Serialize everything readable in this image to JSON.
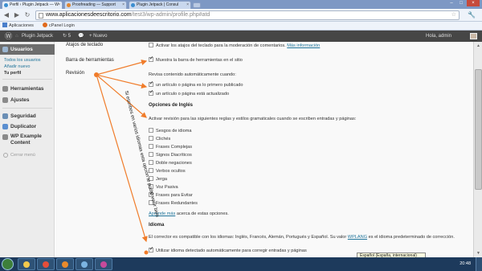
{
  "browser": {
    "tabs": [
      {
        "label": "Perfil ‹ Plugin Jetpack — W",
        "active": true
      },
      {
        "label": "Proofreading — Support",
        "active": false
      },
      {
        "label": "Plugin Jetpack | Consul",
        "active": false
      }
    ],
    "url_host": "www.aplicacionesdeescritorio.com",
    "url_path": "/test3/wp-admin/profile.php#atd",
    "bookmarks": [
      {
        "label": "Aplicaciones"
      },
      {
        "label": "cPanel Login"
      }
    ]
  },
  "admin_bar": {
    "site_name": "Plugin Jetpack",
    "updates_count": "5",
    "new_label": "+ Nuevo",
    "greeting": "Hola, admin"
  },
  "sidebar": {
    "usuarios": "Usuarios",
    "subitems": [
      "Todos los usuarios",
      "Añadir nuevo",
      "Tu perfil"
    ],
    "herramientas": "Herramientas",
    "ajustes": "Ajustes",
    "seguridad": "Seguridad",
    "duplicator": "Duplicator",
    "wp_example_1": "WP Example",
    "wp_example_2": "Content",
    "collapse": "Cerrar menú"
  },
  "main": {
    "top_label": "Atajos de teclado",
    "top_option": "Activar los atajos del teclado para la moderación de comentarios.",
    "top_link": "Más información",
    "toolbar_label": "Barra de herramientas",
    "toolbar_option": "Muestra la barra de herramientas en el sitio",
    "revision_label": "Revisión",
    "revision_desc": "Revisa contenido automáticamente cuando:",
    "revision_opts": [
      {
        "label": "un artículo o página es lo primero publicado",
        "checked": true
      },
      {
        "label": "un artículo o página está actualizado",
        "checked": true
      }
    ],
    "english_title": "Opciones de Inglés",
    "english_desc": "Activar revisión para las siguientes reglas y estilos gramaticales cuando se escriben entradas y páginas:",
    "english_opts": [
      {
        "label": "Sesgos de idioma",
        "checked": false
      },
      {
        "label": "Clichés",
        "checked": false
      },
      {
        "label": "Frases Complejas",
        "checked": false
      },
      {
        "label": "Signos Diacríticos",
        "checked": false
      },
      {
        "label": "Doble negaciones",
        "checked": false
      },
      {
        "label": "Verbos ocultos",
        "checked": false
      },
      {
        "label": "Jerga",
        "checked": false
      },
      {
        "label": "Voz Pasiva",
        "checked": false
      },
      {
        "label": "Frases para Evitar",
        "checked": true
      },
      {
        "label": "Frases Redundantes",
        "checked": false
      }
    ],
    "learn_link": "Aprende más",
    "learn_rest": " acerca de estas opciones.",
    "idioma_title": "Idioma",
    "idioma_desc_1": "El corrector es compatible con los idiomas: Inglés, Francés, Alemán, Portugués y Español. Su valor ",
    "idioma_link": "WPLANG",
    "idioma_desc_2": " es el idioma predeterminado de corrección.",
    "idioma_opt": "Utilizar idioma detectado automáticamente para corregir entradas y páginas"
  },
  "annotation": {
    "text": "Si escribes en varios idiomas esta opción te podrá venir bien",
    "color": "#f07c2a"
  },
  "tooltip": "Español (España, internacional)",
  "taskbar": {
    "clock": "20:48"
  }
}
